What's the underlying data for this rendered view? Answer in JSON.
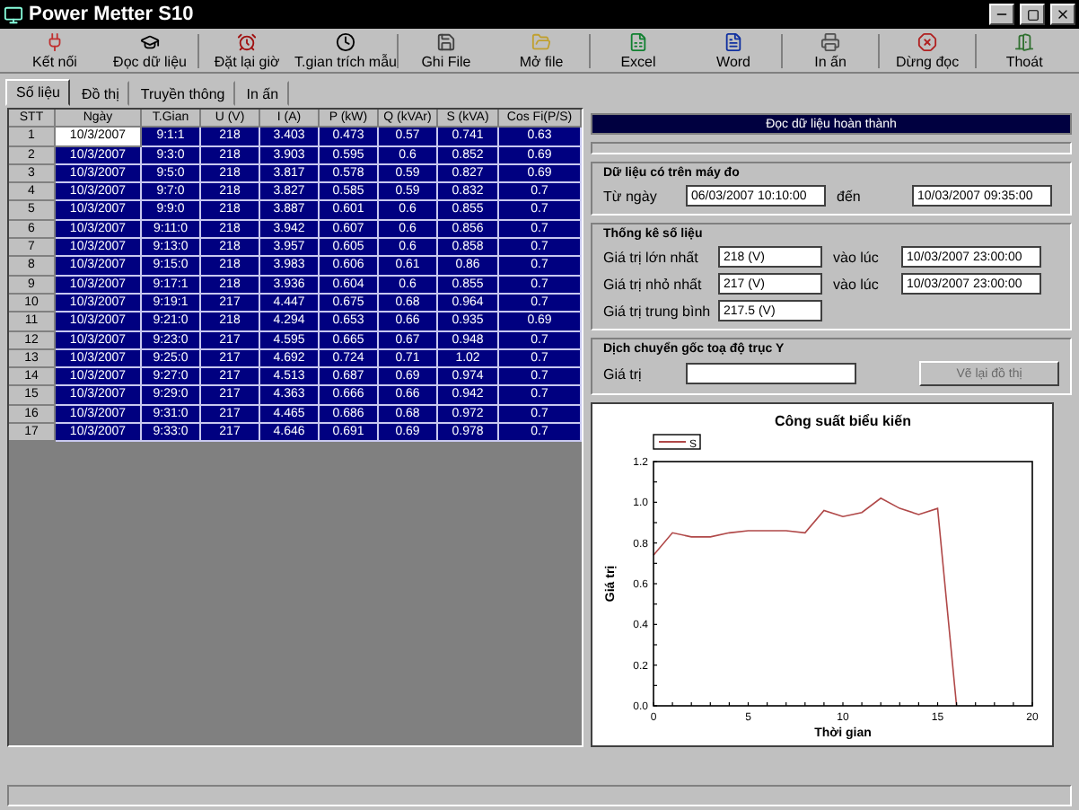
{
  "window": {
    "title": "Power Metter S10"
  },
  "toolbar": [
    "Kết nối",
    "Đọc dữ liệu",
    "Đặt lại giờ",
    "T.gian trích mẫu",
    "Ghi File",
    "Mở file",
    "Excel",
    "Word",
    "In ấn",
    "Dừng đọc",
    "Thoát"
  ],
  "tabs": [
    {
      "label": "Số liệu",
      "selected": true
    },
    {
      "label": "Đồ thị",
      "selected": false
    },
    {
      "label": "Truyền thông",
      "selected": false
    },
    {
      "label": "In ấn",
      "selected": false
    }
  ],
  "table": {
    "columns": [
      "STT",
      "Ngày",
      "T.Gian",
      "U (V)",
      "I (A)",
      "P (kW)",
      "Q (kVAr)",
      "S (kVA)",
      "Cos Fi(P/S)"
    ],
    "rows": [
      {
        "cells": [
          "1",
          "10/3/2007",
          "9:1:1",
          "218",
          "3.403",
          "0.473",
          "0.57",
          "0.741",
          "0.63"
        ],
        "selected": true,
        "editing": true
      },
      {
        "cells": [
          "2",
          "10/3/2007",
          "9:3:0",
          "218",
          "3.903",
          "0.595",
          "0.6",
          "0.852",
          "0.69"
        ],
        "selected": true,
        "editing": false
      },
      {
        "cells": [
          "3",
          "10/3/2007",
          "9:5:0",
          "218",
          "3.817",
          "0.578",
          "0.59",
          "0.827",
          "0.69"
        ],
        "selected": true,
        "editing": false
      },
      {
        "cells": [
          "4",
          "10/3/2007",
          "9:7:0",
          "218",
          "3.827",
          "0.585",
          "0.59",
          "0.832",
          "0.7"
        ],
        "selected": true,
        "editing": false
      },
      {
        "cells": [
          "5",
          "10/3/2007",
          "9:9:0",
          "218",
          "3.887",
          "0.601",
          "0.6",
          "0.855",
          "0.7"
        ],
        "selected": true,
        "editing": false
      },
      {
        "cells": [
          "6",
          "10/3/2007",
          "9:11:0",
          "218",
          "3.942",
          "0.607",
          "0.6",
          "0.856",
          "0.7"
        ],
        "selected": true,
        "editing": false
      },
      {
        "cells": [
          "7",
          "10/3/2007",
          "9:13:0",
          "218",
          "3.957",
          "0.605",
          "0.6",
          "0.858",
          "0.7"
        ],
        "selected": true,
        "editing": false
      },
      {
        "cells": [
          "8",
          "10/3/2007",
          "9:15:0",
          "218",
          "3.983",
          "0.606",
          "0.61",
          "0.86",
          "0.7"
        ],
        "selected": true,
        "editing": false
      },
      {
        "cells": [
          "9",
          "10/3/2007",
          "9:17:1",
          "218",
          "3.936",
          "0.604",
          "0.6",
          "0.855",
          "0.7"
        ],
        "selected": true,
        "editing": false
      },
      {
        "cells": [
          "10",
          "10/3/2007",
          "9:19:1",
          "217",
          "4.447",
          "0.675",
          "0.68",
          "0.964",
          "0.7"
        ],
        "selected": true,
        "editing": false
      },
      {
        "cells": [
          "11",
          "10/3/2007",
          "9:21:0",
          "218",
          "4.294",
          "0.653",
          "0.66",
          "0.935",
          "0.69"
        ],
        "selected": true,
        "editing": false
      },
      {
        "cells": [
          "12",
          "10/3/2007",
          "9:23:0",
          "217",
          "4.595",
          "0.665",
          "0.67",
          "0.948",
          "0.7"
        ],
        "selected": true,
        "editing": false
      },
      {
        "cells": [
          "13",
          "10/3/2007",
          "9:25:0",
          "217",
          "4.692",
          "0.724",
          "0.71",
          "1.02",
          "0.7"
        ],
        "selected": true,
        "editing": false
      },
      {
        "cells": [
          "14",
          "10/3/2007",
          "9:27:0",
          "217",
          "4.513",
          "0.687",
          "0.69",
          "0.974",
          "0.7"
        ],
        "selected": true,
        "editing": false
      },
      {
        "cells": [
          "15",
          "10/3/2007",
          "9:29:0",
          "217",
          "4.363",
          "0.666",
          "0.66",
          "0.942",
          "0.7"
        ],
        "selected": true,
        "editing": false
      },
      {
        "cells": [
          "16",
          "10/3/2007",
          "9:31:0",
          "217",
          "4.465",
          "0.686",
          "0.68",
          "0.972",
          "0.7"
        ],
        "selected": true,
        "editing": false
      },
      {
        "cells": [
          "17",
          "10/3/2007",
          "9:33:0",
          "217",
          "4.646",
          "0.691",
          "0.69",
          "0.978",
          "0.7"
        ],
        "selected": true,
        "editing": false
      }
    ]
  },
  "status_message": "Đọc dữ liệu hoàn thành",
  "range_group": {
    "title": "Dữ liệu có trên máy đo",
    "from_label": "Từ ngày",
    "from": "06/03/2007 10:10:00",
    "to_label": "đến",
    "to": "10/03/2007 09:35:00"
  },
  "stats_group": {
    "title": "Thống kê số liệu",
    "rows": [
      {
        "label": "Giá trị lớn nhất",
        "value": "218 (V)",
        "at_label": "vào lúc",
        "at": "10/03/2007 23:00:00"
      },
      {
        "label": "Giá trị nhỏ nhất",
        "value": "217 (V)",
        "at_label": "vào lúc",
        "at": "10/03/2007 23:00:00"
      },
      {
        "label": "Giá trị trung bình",
        "value": "217.5 (V)"
      }
    ]
  },
  "offset_group": {
    "title": "Dịch chuyển gốc toạ độ trục Y",
    "label": "Giá trị",
    "button": {
      "label": "Vẽ lại đồ thị",
      "disabled": true
    }
  },
  "chart": {
    "chart_data": {
      "type": "line",
      "title": "Công suất biểu kiến",
      "xlabel": "Thời gian",
      "ylabel": "Giá trị",
      "x": [
        0,
        1,
        2,
        3,
        4,
        5,
        6,
        7,
        8,
        9,
        10,
        11,
        12,
        13,
        14,
        15,
        16
      ],
      "series": [
        {
          "name": "S",
          "color": "#b04848",
          "values": [
            0.74,
            0.85,
            0.83,
            0.83,
            0.85,
            0.86,
            0.86,
            0.86,
            0.85,
            0.96,
            0.93,
            0.95,
            1.02,
            0.97,
            0.94,
            0.97,
            0
          ]
        }
      ],
      "xlim": [
        0,
        20
      ],
      "ylim": [
        0,
        1.2
      ],
      "xticks": [
        0,
        5,
        10,
        15,
        20
      ],
      "yticks": [
        {
          "value": 0,
          "label": "0.0"
        },
        0.2,
        0.4,
        0.6,
        0.8,
        {
          "value": 1,
          "label": "1.0"
        },
        1.2
      ]
    }
  }
}
